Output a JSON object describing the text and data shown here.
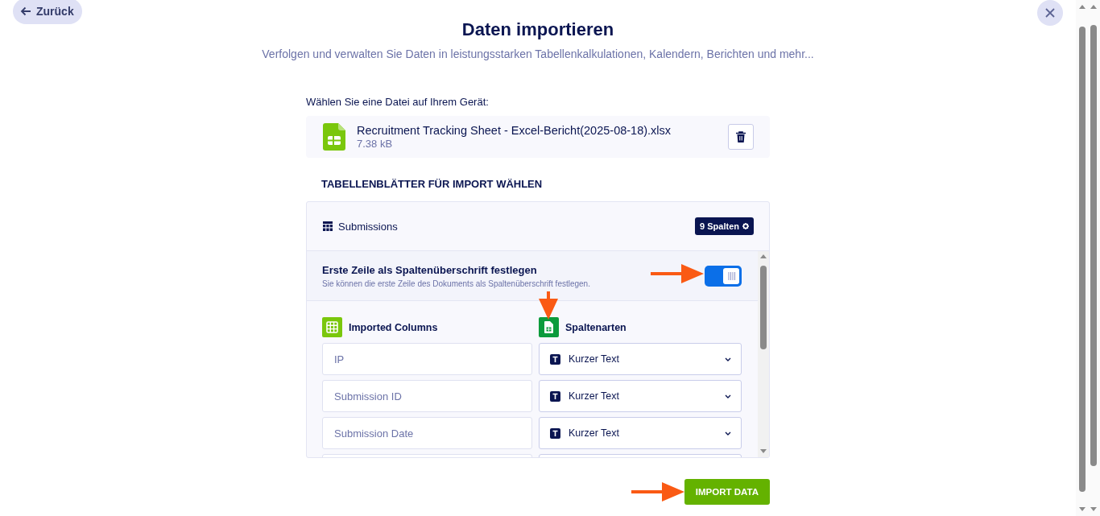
{
  "back_button": {
    "label": "Zurück"
  },
  "title": "Daten importieren",
  "subtitle": "Verfolgen und verwalten Sie Daten in leistungsstarken Tabellenkalkulationen, Kalendern, Berichten und mehr...",
  "file_prompt": "Wählen Sie eine Datei auf Ihrem Gerät:",
  "file": {
    "name": "Recruitment Tracking Sheet - Excel-Bericht(2025-08-18).xlsx",
    "size": "7.38 kB"
  },
  "sheets_heading": "TABELLENBLÄTTER FÜR IMPORT WÄHLEN",
  "sheet": {
    "name": "Submissions",
    "columns_badge": "9 Spalten"
  },
  "header_toggle": {
    "title": "Erste Zeile als Spaltenüberschrift festlegen",
    "description": "Sie können die erste Zeile des Dokuments als Spaltenüberschrift festlegen.",
    "on": true
  },
  "column_headings": [
    "Imported Columns",
    "Spaltenarten"
  ],
  "columns": [
    {
      "kind": "mapping",
      "name": "IP",
      "type": "Kurzer Text"
    },
    {
      "kind": "mapping",
      "name": "Submission ID",
      "type": "Kurzer Text"
    },
    {
      "kind": "mapping",
      "name": "Submission Date",
      "type": "Kurzer Text"
    },
    {
      "kind": "cut"
    }
  ],
  "import_button": {
    "label": "IMPORT DATA"
  }
}
